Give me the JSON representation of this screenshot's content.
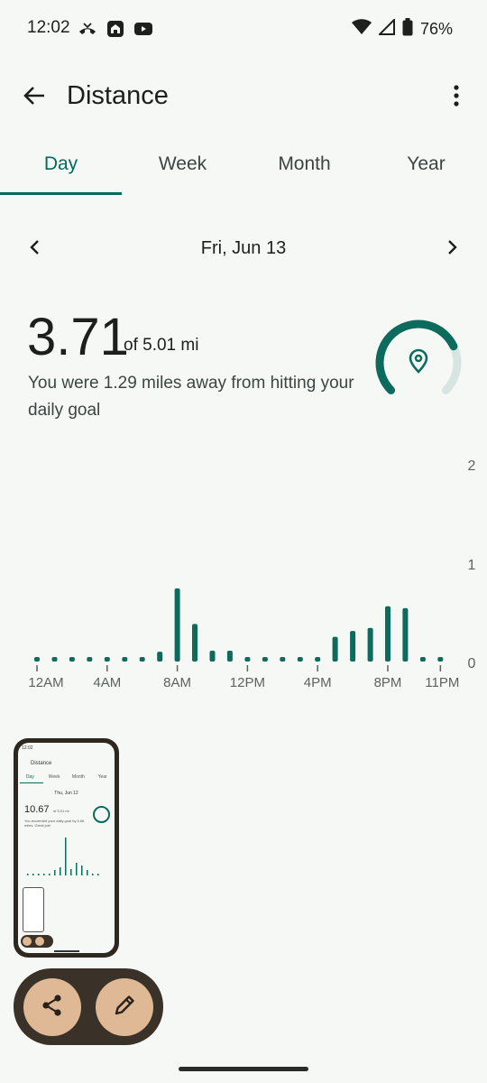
{
  "status_bar": {
    "time": "12:02",
    "battery": "76%"
  },
  "app_bar": {
    "title": "Distance"
  },
  "tabs": [
    {
      "label": "Day",
      "active": true
    },
    {
      "label": "Week",
      "active": false
    },
    {
      "label": "Month",
      "active": false
    },
    {
      "label": "Year",
      "active": false
    }
  ],
  "date_nav": {
    "label": "Fri, Jun 13"
  },
  "summary": {
    "value": "3.71",
    "goal": "of 5.01 mi",
    "message": "You were 1.29 miles away from hitting your daily goal",
    "progress": 0.74,
    "icon": "location-pin-icon"
  },
  "chart_data": {
    "type": "bar",
    "x_tick_labels": [
      "12AM",
      "4AM",
      "8AM",
      "12PM",
      "4PM",
      "8PM",
      "11PM"
    ],
    "y_tick_labels": [
      "0",
      "1",
      "2"
    ],
    "ylim": [
      0,
      2
    ],
    "hours": [
      0,
      1,
      2,
      3,
      4,
      5,
      6,
      7,
      8,
      9,
      10,
      11,
      12,
      13,
      14,
      15,
      16,
      17,
      18,
      19,
      20,
      21,
      22,
      23
    ],
    "values": [
      0.03,
      0.03,
      0.03,
      0.03,
      0.03,
      0.03,
      0.03,
      0.1,
      0.74,
      0.38,
      0.11,
      0.11,
      0.03,
      0.03,
      0.03,
      0.03,
      0.03,
      0.25,
      0.31,
      0.34,
      0.56,
      0.54,
      0.03,
      0.03
    ],
    "bar_color": "#0c6b5c"
  },
  "preview": {
    "time": "12:02",
    "title": "Distance",
    "tabs": [
      "Day",
      "Week",
      "Month",
      "Year"
    ],
    "date": "Thu, Jun 12",
    "value": "10.67",
    "goal": "of 5.01 mi",
    "message": "You exceeded your daily goal by 5.66 miles. Great job!"
  },
  "colors": {
    "accent": "#006b5b",
    "fab_bg": "#3a3129",
    "fab_button": "#dfb995"
  }
}
